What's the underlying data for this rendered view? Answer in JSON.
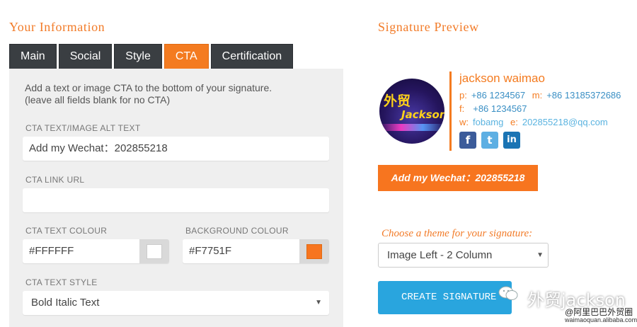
{
  "left": {
    "title": "Your Information",
    "tabs": [
      "Main",
      "Social",
      "Style",
      "CTA",
      "Certification"
    ],
    "active_tab": "CTA",
    "intro": [
      "Add a text or image CTA to the bottom of your signature.",
      "(leave all fields blank for no CTA)"
    ],
    "cta_text": {
      "label": "CTA TEXT/IMAGE ALT TEXT",
      "value": "Add my Wechat：202855218"
    },
    "cta_link": {
      "label": "CTA LINK URL",
      "value": ""
    },
    "text_colour": {
      "label": "CTA TEXT COLOUR",
      "value": "#FFFFFF"
    },
    "background_colour": {
      "label": "BACKGROUND COLOUR",
      "value": "#F7751F"
    },
    "text_style": {
      "label": "CTA TEXT STYLE",
      "value": "Bold Italic Text"
    }
  },
  "right": {
    "title": "Signature Preview",
    "avatar": {
      "cn": "外贸",
      "en": "Jackson"
    },
    "name": "jackson waimao",
    "phone": {
      "key": "p:",
      "value": "+86 1234567"
    },
    "mobile": {
      "key": "m:",
      "value": "+86 13185372686"
    },
    "fax": {
      "key": "f:",
      "value": "+86 1234567"
    },
    "web": {
      "key": "w:",
      "value": "fobamg"
    },
    "email": {
      "key": "e:",
      "value": "202855218@qq.com"
    },
    "social_icons": [
      "facebook-icon",
      "twitter-icon",
      "linkedin-icon"
    ],
    "social_glyphs": {
      "facebook": "f",
      "twitter": "t",
      "linkedin": "in"
    },
    "cta_preview": "Add my Wechat：202855218",
    "theme_label": "Choose a theme for your signature:",
    "theme_value": "Image Left - 2 Column",
    "create_button": "CREATE SIGNATURE"
  },
  "watermark": {
    "text": "外贸jackson",
    "sub": "@阿里巴巴外贸圈",
    "url": "waimaoquan.alibaba.com"
  },
  "colors": {
    "accent": "#F47B20",
    "tab_dark": "#3A3E42",
    "button_blue": "#29A5DE",
    "link_blue": "#3A8FC4"
  }
}
